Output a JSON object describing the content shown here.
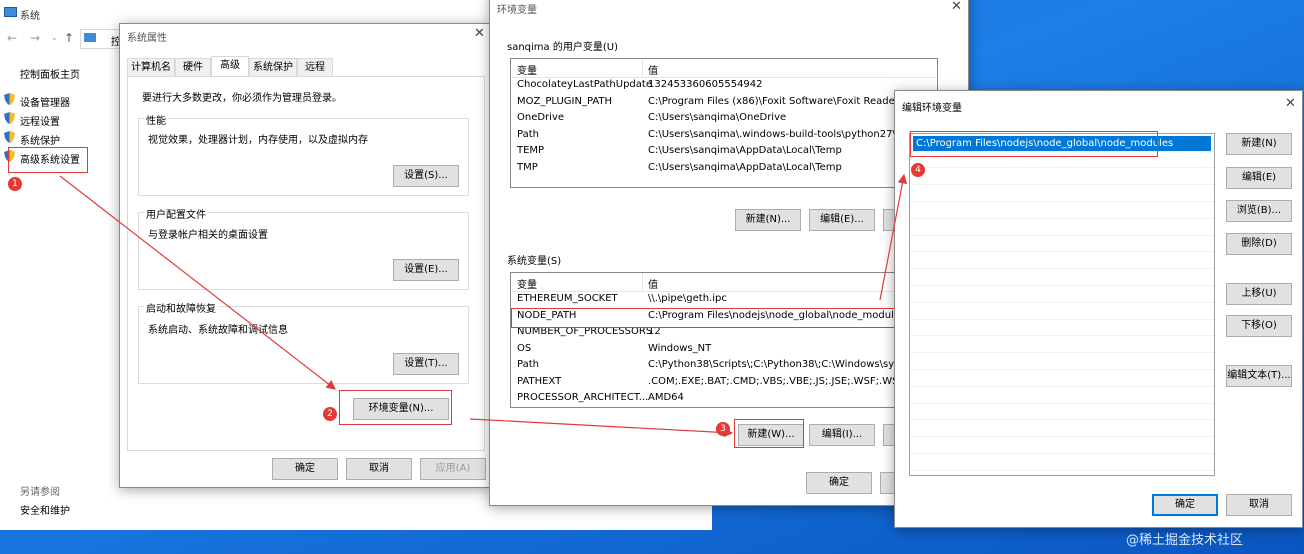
{
  "system_window": {
    "title": "系统",
    "address_text": "控",
    "sidebar_home": "控制面板主页",
    "links": [
      "设备管理器",
      "远程设置",
      "系统保护",
      "高级系统设置"
    ],
    "see_also": "另请参阅",
    "security": "安全和维护"
  },
  "sysprops": {
    "title": "系统属性",
    "tabs": [
      "计算机名",
      "硬件",
      "高级",
      "系统保护",
      "远程"
    ],
    "admin_note": "要进行大多数更改，你必须作为管理员登录。",
    "perf_title": "性能",
    "perf_desc": "视觉效果，处理器计划，内存使用，以及虚拟内存",
    "perf_btn": "设置(S)...",
    "profile_title": "用户配置文件",
    "profile_desc": "与登录帐户相关的桌面设置",
    "profile_btn": "设置(E)...",
    "startup_title": "启动和故障恢复",
    "startup_desc": "系统启动、系统故障和调试信息",
    "startup_btn": "设置(T)...",
    "env_btn": "环境变量(N)...",
    "ok": "确定",
    "cancel": "取消",
    "apply": "应用(A)"
  },
  "envvars": {
    "title": "环境变量",
    "user_group": "sanqima 的用户变量(U)",
    "col_var": "变量",
    "col_val": "值",
    "user_rows": [
      {
        "name": "ChocolateyLastPathUpdate",
        "value": "132453360605554942"
      },
      {
        "name": "MOZ_PLUGIN_PATH",
        "value": "C:\\Program Files (x86)\\Foxit Software\\Foxit Reader\\plug"
      },
      {
        "name": "OneDrive",
        "value": "C:\\Users\\sanqima\\OneDrive"
      },
      {
        "name": "Path",
        "value": "C:\\Users\\sanqima\\.windows-build-tools\\python27\\;C:\\U"
      },
      {
        "name": "TEMP",
        "value": "C:\\Users\\sanqima\\AppData\\Local\\Temp"
      },
      {
        "name": "TMP",
        "value": "C:\\Users\\sanqima\\AppData\\Local\\Temp"
      }
    ],
    "user_new": "新建(N)...",
    "user_edit": "编辑(E)...",
    "sys_group": "系统变量(S)",
    "sys_rows": [
      {
        "name": "ETHEREUM_SOCKET",
        "value": "\\\\.\\pipe\\geth.ipc"
      },
      {
        "name": "NODE_PATH",
        "value": "C:\\Program Files\\nodejs\\node_global\\node_modules;"
      },
      {
        "name": "NUMBER_OF_PROCESSORS",
        "value": "12"
      },
      {
        "name": "OS",
        "value": "Windows_NT"
      },
      {
        "name": "Path",
        "value": "C:\\Python38\\Scripts\\;C:\\Python38\\;C:\\Windows\\system3"
      },
      {
        "name": "PATHEXT",
        "value": ".COM;.EXE;.BAT;.CMD;.VBS;.VBE;.JS;.JSE;.WSF;.WSH;.MSC"
      },
      {
        "name": "PROCESSOR_ARCHITECT...",
        "value": "AMD64"
      }
    ],
    "sys_new": "新建(W)...",
    "sys_edit": "编辑(I)...",
    "ok": "确定"
  },
  "editenv": {
    "title": "编辑环境变量",
    "entry": "C:\\Program Files\\nodejs\\node_global\\node_modules",
    "buttons": [
      "新建(N)",
      "编辑(E)",
      "浏览(B)...",
      "删除(D)",
      "上移(U)",
      "下移(O)",
      "编辑文本(T)..."
    ],
    "ok": "确定",
    "cancel": "取消"
  },
  "badges": [
    "1",
    "2",
    "3",
    "4"
  ],
  "watermark": "@稀土掘金技术社区",
  "colors": {
    "annotation": "#e03a3a",
    "selection": "#0078d7",
    "desktop": "#1d7ee6"
  }
}
